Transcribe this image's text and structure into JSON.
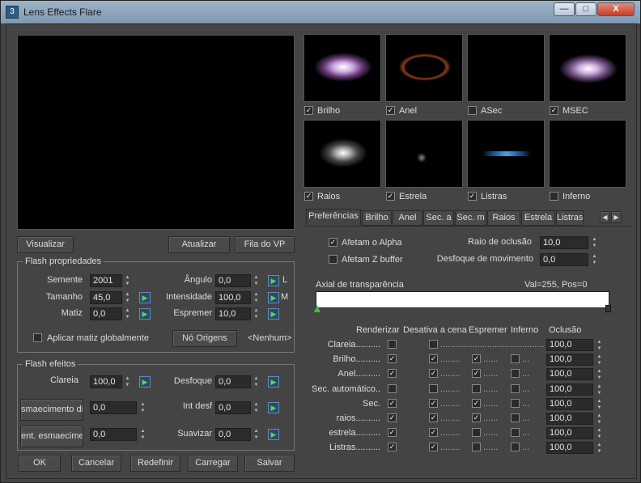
{
  "window": {
    "title": "Lens Effects Flare",
    "min": "—",
    "max": "□",
    "close": "X"
  },
  "buttons": {
    "visualizar": "Visualizar",
    "atualizar": "Atualizar",
    "fila": "Fila do VP",
    "ok": "OK",
    "cancelar": "Cancelar",
    "redefinir": "Redefinir",
    "carregar": "Carregar",
    "salvar": "Salvar",
    "no_origens": "Nó Origens"
  },
  "flash_prop": {
    "title": "Flash propriedades",
    "semente_label": "Semente",
    "semente": "2001",
    "tamanho_label": "Tamanho",
    "tamanho": "45,0",
    "matiz_label": "Matiz",
    "matiz": "0,0",
    "angulo_label": "Ângulo",
    "angulo": "0,0",
    "intensidade_label": "Intensidade",
    "intensidade": "100,0",
    "espremer_label": "Espremer",
    "espremer": "10,0",
    "aplicar": "Aplicar matiz globalmente",
    "lock_l": "L",
    "lock_m": "M",
    "nenhum": "<Nenhum>"
  },
  "flash_efeitos": {
    "title": "Flash efeitos",
    "clareia_label": "Clareia",
    "clareia": "100,0",
    "desfoque_label": "Desfoque",
    "desfoque": "0,0",
    "btn_esm_dis": "smaecimento dis",
    "esm_dis": "0,0",
    "int_desf_label": "Int desf",
    "int_desf": "0,0",
    "btn_esm_cen": "ent. esmaecimen",
    "esm_cen": "0,0",
    "suavizar_label": "Suavizar",
    "suavizar": "0,0"
  },
  "thumbs": [
    {
      "label": "Brilho",
      "checked": true
    },
    {
      "label": "Anel",
      "checked": true
    },
    {
      "label": "ASec",
      "checked": false
    },
    {
      "label": "MSEC",
      "checked": true
    },
    {
      "label": "Raios",
      "checked": true
    },
    {
      "label": "Estrela",
      "checked": true
    },
    {
      "label": "Listras",
      "checked": true
    },
    {
      "label": "Inferno",
      "checked": false
    }
  ],
  "tabs": [
    "Preferências",
    "Brilho",
    "Anel",
    "Sec. a",
    "Sec. m",
    "Raios",
    "Estrela",
    "Listras"
  ],
  "prefs": {
    "afetam_alpha": "Afetam o Alpha",
    "afetam_z": "Afetam Z buffer",
    "raio_oclusao_label": "Raio de oclusão",
    "raio_oclusao": "10,0",
    "desfoque_mov_label": "Desfoque de movimento",
    "desfoque_mov": "0,0",
    "axial": "Axial de transparência",
    "val": "Val=255, Pos=0"
  },
  "table": {
    "headers": [
      "Renderizar",
      "Desativa a cena",
      "Espremer",
      "Inferno",
      "Oclusão"
    ],
    "rows": [
      {
        "label": "Clareia..........",
        "r": false,
        "d": false,
        "e": null,
        "i": null,
        "o": "100,0"
      },
      {
        "label": "Brilho..........",
        "r": true,
        "d": true,
        "e": true,
        "i": false,
        "o": "100,0"
      },
      {
        "label": "Anel..........",
        "r": true,
        "d": true,
        "e": true,
        "i": false,
        "o": "100,0"
      },
      {
        "label": "Sec. automático..",
        "r": false,
        "d": false,
        "e": false,
        "i": false,
        "o": "100,0"
      },
      {
        "label": "Sec.",
        "r": true,
        "d": true,
        "e": true,
        "i": false,
        "o": "100,0"
      },
      {
        "label": "raios..........",
        "r": true,
        "d": true,
        "e": true,
        "i": false,
        "o": "100,0"
      },
      {
        "label": "estrela..........",
        "r": true,
        "d": true,
        "e": false,
        "i": false,
        "o": "100,0"
      },
      {
        "label": "Listras..........",
        "r": true,
        "d": true,
        "e": false,
        "i": false,
        "o": "100,0"
      }
    ]
  },
  "colors": {
    "accent": "#5ed05e",
    "bg": "#444444"
  }
}
